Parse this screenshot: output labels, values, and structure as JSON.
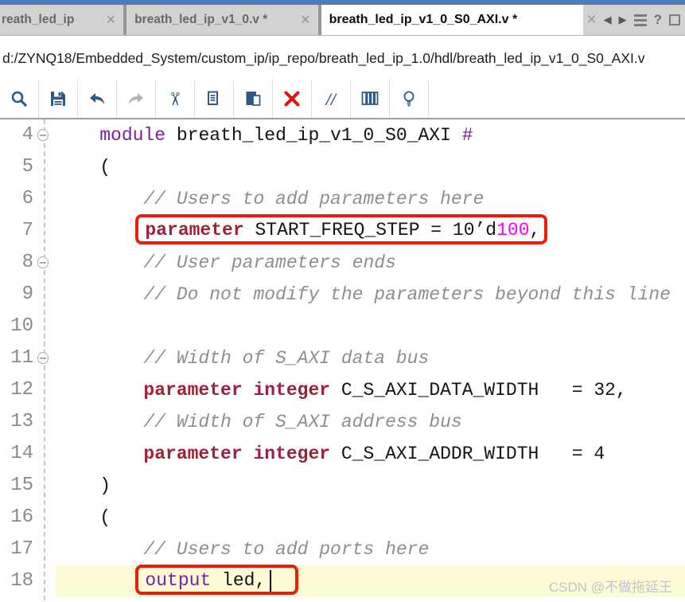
{
  "colors": {
    "accent_blue": "#4a7ebb",
    "toolbar_icon_blue": "#2d5a87",
    "toolbar_delete_red": "#e01313",
    "annotation_red": "#ee1c0c",
    "current_line_yellow": "#fdfad6",
    "keyword_purple": "#7b1fa2",
    "type_keyword_maroon": "#9e2139",
    "comment_gray": "#8e8e8e",
    "number_magenta": "#ff00ff"
  },
  "tabs": {
    "close_glyph": "×",
    "items": [
      {
        "label": "reath_led_ip",
        "active": false
      },
      {
        "label": "breath_led_ip_v1_0.v *",
        "active": false
      },
      {
        "label": "breath_led_ip_v1_0_S0_AXI.v *",
        "active": true
      }
    ],
    "nav": {
      "close": "×",
      "back": "◀",
      "forward": "▶",
      "help": "?"
    }
  },
  "path_bar": {
    "path": "d:/ZYNQ18/Embedded_System/custom_ip/ip_repo/breath_led_ip_1.0/hdl/breath_led_ip_v1_0_S0_AXI.v"
  },
  "toolbar": {
    "icons": [
      {
        "name": "search-icon"
      },
      {
        "name": "save-icon"
      },
      {
        "name": "undo-icon"
      },
      {
        "name": "redo-icon",
        "disabled": true
      },
      {
        "name": "cut-icon"
      },
      {
        "name": "copy-icon"
      },
      {
        "name": "paste-icon"
      },
      {
        "name": "delete-icon",
        "danger": true
      },
      {
        "name": "comment-icon",
        "label": "//"
      },
      {
        "name": "columns-icon"
      },
      {
        "name": "lightbulb-icon"
      }
    ]
  },
  "editor": {
    "lines": [
      {
        "num": 4,
        "fold": true,
        "indent": 4,
        "tokens": [
          {
            "t": "module",
            "c": "kw"
          },
          {
            "t": " breath_led_ip_v1_0_S0_AXI ",
            "c": "pl"
          },
          {
            "t": "#",
            "c": "kw"
          }
        ]
      },
      {
        "num": 5,
        "indent": 4,
        "tokens": [
          {
            "t": "(",
            "c": "pl"
          }
        ]
      },
      {
        "num": 6,
        "indent": 8,
        "tokens": [
          {
            "t": "// Users to add parameters here",
            "c": "cm"
          }
        ]
      },
      {
        "num": 7,
        "indent": 8,
        "boxed": true,
        "tokens": [
          {
            "t": "parameter",
            "c": "kw2"
          },
          {
            "t": " START_FREQ_STEP = 10’d",
            "c": "pl"
          },
          {
            "t": "100",
            "c": "num"
          },
          {
            "t": ",",
            "c": "pl"
          }
        ]
      },
      {
        "num": 8,
        "fold": true,
        "indent": 8,
        "tokens": [
          {
            "t": "// User parameters ends",
            "c": "cm"
          }
        ]
      },
      {
        "num": 9,
        "indent": 8,
        "tokens": [
          {
            "t": "// Do not modify the parameters beyond this line",
            "c": "cm"
          }
        ]
      },
      {
        "num": 10,
        "indent": 0,
        "tokens": []
      },
      {
        "num": 11,
        "fold": true,
        "indent": 8,
        "tokens": [
          {
            "t": "// Width of S_AXI data bus",
            "c": "cm"
          }
        ]
      },
      {
        "num": 12,
        "indent": 8,
        "tokens": [
          {
            "t": "parameter",
            "c": "kw2"
          },
          {
            "t": " ",
            "c": "pl"
          },
          {
            "t": "integer",
            "c": "kw2"
          },
          {
            "t": " C_S_AXI_DATA_WIDTH   = 32,",
            "c": "pl"
          }
        ]
      },
      {
        "num": 13,
        "indent": 8,
        "tokens": [
          {
            "t": "// Width of S_AXI address bus",
            "c": "cm"
          }
        ]
      },
      {
        "num": 14,
        "indent": 8,
        "tokens": [
          {
            "t": "parameter",
            "c": "kw2"
          },
          {
            "t": " ",
            "c": "pl"
          },
          {
            "t": "integer",
            "c": "kw2"
          },
          {
            "t": " C_S_AXI_ADDR_WIDTH   = 4",
            "c": "pl"
          }
        ]
      },
      {
        "num": 15,
        "indent": 4,
        "tokens": [
          {
            "t": ")",
            "c": "pl"
          }
        ]
      },
      {
        "num": 16,
        "indent": 4,
        "tokens": [
          {
            "t": "(",
            "c": "pl"
          }
        ]
      },
      {
        "num": 17,
        "indent": 8,
        "tokens": [
          {
            "t": "// Users to add ports here",
            "c": "cm"
          }
        ]
      },
      {
        "num": 18,
        "indent": 8,
        "boxed": true,
        "highlighted": true,
        "cursor": true,
        "tokens": [
          {
            "t": "output",
            "c": "kw"
          },
          {
            "t": " led,",
            "c": "pl"
          }
        ]
      }
    ]
  },
  "watermark": {
    "text": "CSDN @不做拖延王"
  }
}
